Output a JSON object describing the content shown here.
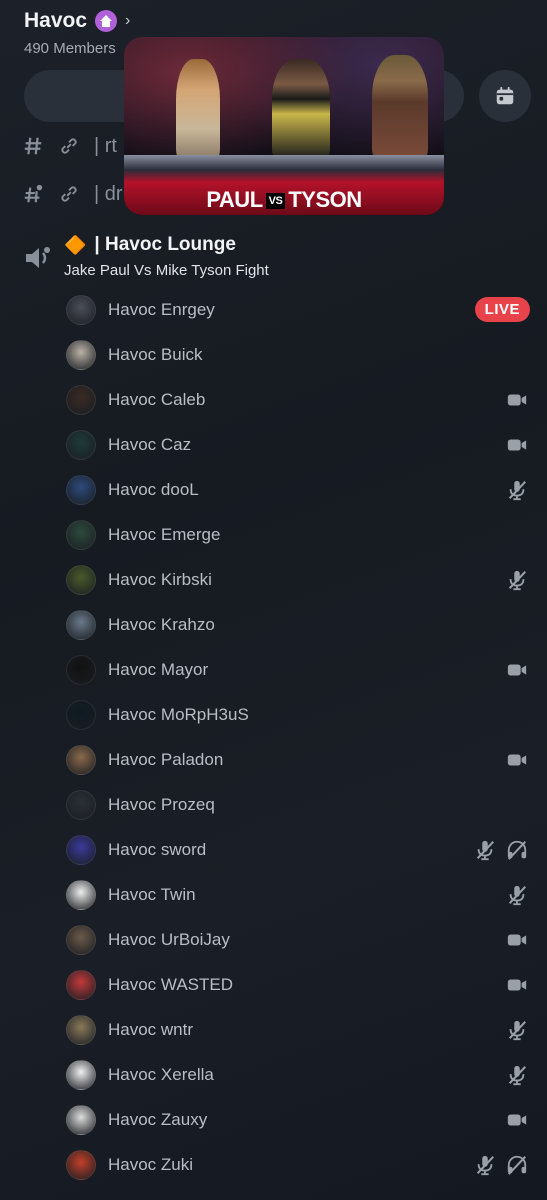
{
  "server": {
    "name": "Havoc",
    "member_count": "490 Members"
  },
  "channels": [
    {
      "icon": "hash-icon",
      "text": "| rt"
    },
    {
      "icon": "locked-hash-icon",
      "text": "| dr"
    }
  ],
  "video": {
    "banner_left": "PAUL",
    "banner_vs": "VS",
    "banner_right": "TYSON"
  },
  "voice_channel": {
    "emoji": "🔶",
    "title": "| Havoc Lounge",
    "topic": "Jake Paul Vs Mike Tyson Fight"
  },
  "live_label": "LIVE",
  "members": [
    {
      "name": "Havoc Enrgey",
      "avatar_color": "#4a4e58",
      "status": [
        "live"
      ]
    },
    {
      "name": "Havoc Buick",
      "avatar_color": "#b9b2a6",
      "status": []
    },
    {
      "name": "Havoc Caleb",
      "avatar_color": "#3a2a24",
      "status": [
        "video"
      ]
    },
    {
      "name": "Havoc Caz",
      "avatar_color": "#1f3a3a",
      "status": [
        "video"
      ]
    },
    {
      "name": "Havoc dooL",
      "avatar_color": "#2c4a7a",
      "status": [
        "muted"
      ]
    },
    {
      "name": "Havoc Emerge",
      "avatar_color": "#2e4a3c",
      "status": []
    },
    {
      "name": "Havoc Kirbski",
      "avatar_color": "#4a5a2a",
      "status": [
        "muted"
      ]
    },
    {
      "name": "Havoc Krahzo",
      "avatar_color": "#6a7a8a",
      "status": []
    },
    {
      "name": "Havoc Mayor",
      "avatar_color": "#111111",
      "status": [
        "video"
      ]
    },
    {
      "name": "Havoc MoRpH3uS",
      "avatar_color": "#0d1a22",
      "status": []
    },
    {
      "name": "Havoc Paladon",
      "avatar_color": "#8a6a4a",
      "status": [
        "video"
      ]
    },
    {
      "name": "Havoc Prozeq",
      "avatar_color": "#2a3038",
      "status": []
    },
    {
      "name": "Havoc sword",
      "avatar_color": "#3a3a9a",
      "status": [
        "muted",
        "deafened"
      ]
    },
    {
      "name": "Havoc Twin",
      "avatar_color": "#eeeeee",
      "status": [
        "muted"
      ]
    },
    {
      "name": "Havoc UrBoiJay",
      "avatar_color": "#6a5a4a",
      "status": [
        "video"
      ]
    },
    {
      "name": "Havoc WASTED",
      "avatar_color": "#c23a3a",
      "status": [
        "video"
      ]
    },
    {
      "name": "Havoc wntr",
      "avatar_color": "#8a7a5a",
      "status": [
        "muted"
      ]
    },
    {
      "name": "Havoc Xerella",
      "avatar_color": "#f0f0f0",
      "status": [
        "muted"
      ]
    },
    {
      "name": "Havoc Zauxy",
      "avatar_color": "#dcdcdc",
      "status": [
        "video"
      ]
    },
    {
      "name": "Havoc Zuki",
      "avatar_color": "#c2402a",
      "status": [
        "muted",
        "deafened"
      ]
    }
  ],
  "colors": {
    "live": "#e8424a",
    "boost": "#b061d9",
    "icon": "#9aa0a8"
  }
}
